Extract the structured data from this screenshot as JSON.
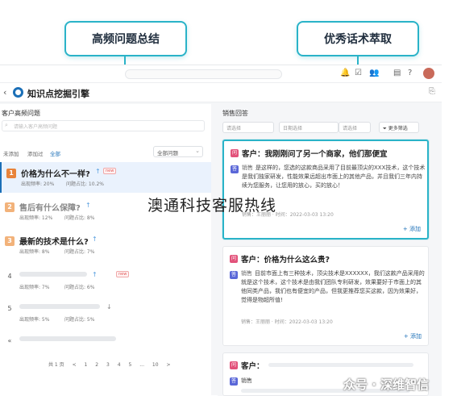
{
  "callouts": {
    "left": "高频问题总结",
    "right": "优秀话术萃取"
  },
  "topbar": {
    "icons": [
      "bell-icon",
      "checklist-icon",
      "team-icon",
      "doc-icon",
      "help-icon"
    ]
  },
  "app": {
    "title": "知识点挖掘引擎"
  },
  "left_panel": {
    "label": "客户高频问题",
    "search_placeholder": "请输入客户高频问题",
    "filters": [
      "未添加",
      "添加过",
      "全部"
    ],
    "dropdown": "全部问题",
    "questions": [
      {
        "num": "1",
        "title": "价格为什么不一样?",
        "freq": "出现频率: 20%",
        "ratio": "问题占比: 10.2%",
        "badge": "new",
        "color": "#e8833a"
      },
      {
        "num": "2",
        "title": "售后有什么保障?",
        "freq": "出现频率: 12%",
        "ratio": "问题占比: 8%",
        "badge": "",
        "color": "#f2b27a"
      },
      {
        "num": "3",
        "title": "最新的技术是什么?",
        "freq": "出现频率: 8%",
        "ratio": "问题占比: 7%",
        "badge": "",
        "color": "#f2b27a"
      },
      {
        "num": "4",
        "title": "",
        "freq": "出现频率: 7%",
        "ratio": "问题占比: 6%",
        "badge": "new",
        "color": ""
      },
      {
        "num": "5",
        "title": "",
        "freq": "出现频率: 5%",
        "ratio": "问题占比: 5%",
        "badge": "",
        "color": ""
      },
      {
        "num": "6",
        "title": "",
        "freq": "",
        "ratio": "",
        "badge": "",
        "color": ""
      }
    ],
    "pager": [
      "共 1 页",
      "<",
      "1",
      "2",
      "3",
      "4",
      "5",
      "...",
      "10",
      ">"
    ]
  },
  "right_panel": {
    "label": "销售回答",
    "filters": [
      "请选择",
      "日期选择",
      "请选择"
    ],
    "more_button": "更多筛选",
    "cards": [
      {
        "question": "客户：我刚刚问了另一个商家，他们那便宜",
        "tag": "销售",
        "answer": "是这样的，您选的这款商品采用了目前最顶尖的XXX技术，这个技术是我们独家研发，性能效果远超出市面上的其他产品，并且我们三年内持续为您服务，让您用的放心，买的放心！",
        "meta": "销售：王丽丽  ·  时间：2022-03-03 13:20",
        "add": "+ 添加"
      },
      {
        "question": "客户：价格为什么这么贵?",
        "tag": "销售",
        "answer": "目前市面上有三种技术，顶尖技术是XXXXXX，我们这款产品采用的就是这个技术，这个技术是由我们团队专利研发，效果要好于市面上的其他同类产品，我们也有便宜的产品，但我更推荐您买这款，因为效果好，觉得是物超所值!",
        "meta": "销售：王丽丽  ·  时间：2022-03-03 13:20",
        "add": "+ 添加"
      },
      {
        "question": "客户：",
        "tag": "销售",
        "answer": "",
        "meta": "",
        "add": ""
      }
    ]
  },
  "overlay": {
    "center_text": "澳通科技客服热线",
    "watermark": "众号 · 深维智信"
  },
  "colors": {
    "accent": "#2ab3c8",
    "brand": "#1b6fb7",
    "question_chip": "#e2527a",
    "answer_chip": "#5a67d8"
  }
}
